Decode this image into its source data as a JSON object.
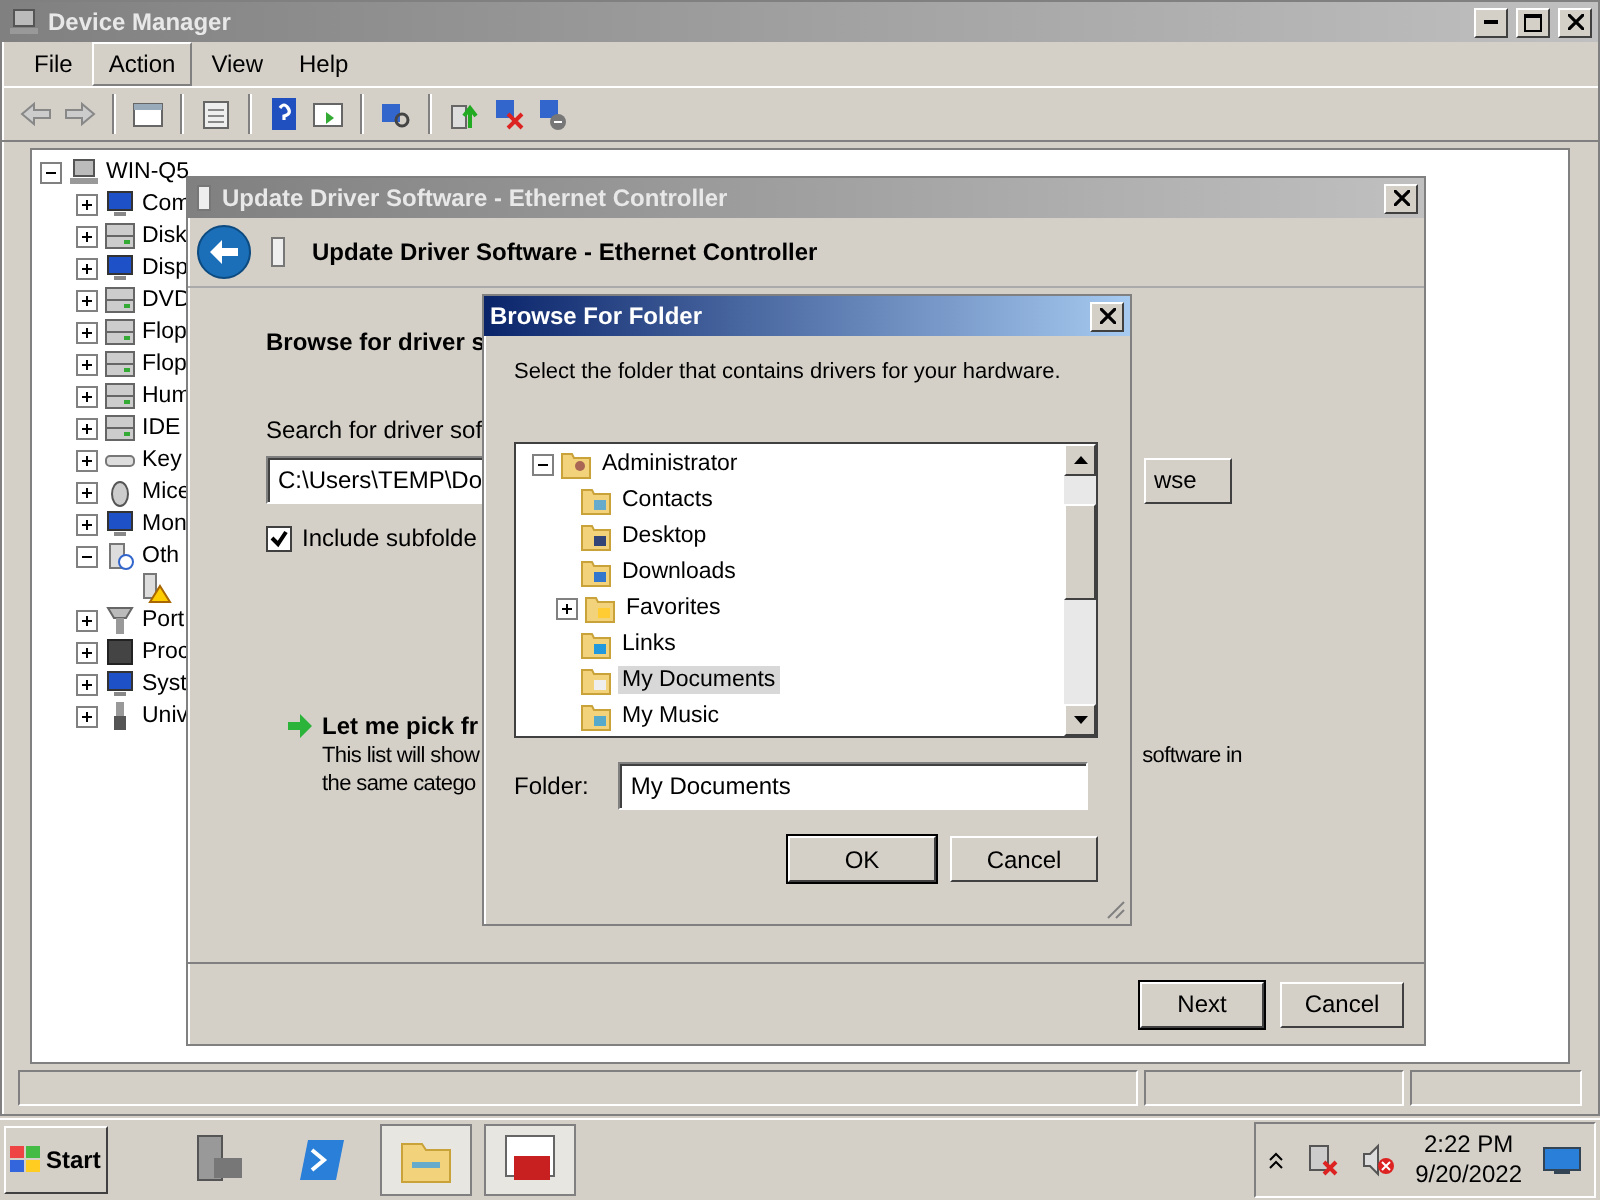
{
  "device_manager": {
    "title": "Device Manager",
    "menu": [
      {
        "label": "File",
        "selected": false
      },
      {
        "label": "Action",
        "selected": true
      },
      {
        "label": "View",
        "selected": false
      },
      {
        "label": "Help",
        "selected": false
      }
    ],
    "tree": {
      "label": "WIN-Q5",
      "expanded": true,
      "children": [
        {
          "label": "Com",
          "expanded": false
        },
        {
          "label": "Disk",
          "expanded": false
        },
        {
          "label": "Disp",
          "expanded": false
        },
        {
          "label": "DVD",
          "expanded": false
        },
        {
          "label": "Flop",
          "expanded": false
        },
        {
          "label": "Flop",
          "expanded": false
        },
        {
          "label": "Hum",
          "expanded": false
        },
        {
          "label": "IDE",
          "expanded": false
        },
        {
          "label": "Key",
          "expanded": false
        },
        {
          "label": "Mice",
          "expanded": false
        },
        {
          "label": "Mon",
          "expanded": false
        },
        {
          "label": "Oth",
          "expanded": true,
          "children": [
            {
              "kind": "warning"
            }
          ]
        },
        {
          "label": "Port",
          "expanded": false
        },
        {
          "label": "Proc",
          "expanded": false
        },
        {
          "label": "Syst",
          "expanded": false
        },
        {
          "label": "Univ",
          "expanded": false
        }
      ]
    }
  },
  "update_driver": {
    "title": "Update Driver Software - Ethernet Controller",
    "header": "Update Driver Software - Ethernet Controller",
    "heading": "Browse for driver s",
    "search_label": "Search for driver sof",
    "path_value": "C:\\Users\\TEMP\\Do",
    "browse_button": "wse",
    "include_subfolders": {
      "label": "Include subfolde",
      "checked": true
    },
    "pick_link": {
      "title": "Let me pick fr",
      "lines": [
        {
          "left": "This list will show",
          "right": "software in"
        },
        {
          "left": "the same catego"
        }
      ]
    },
    "buttons": [
      "Next",
      "Cancel"
    ]
  },
  "browse_folder": {
    "title": "Browse For Folder",
    "instruction": "Select the folder that contains drivers for your hardware.",
    "tree": {
      "label": "Administrator",
      "expanded": true,
      "children": [
        {
          "label": "Contacts",
          "selected": false
        },
        {
          "label": "Desktop",
          "selected": false
        },
        {
          "label": "Downloads",
          "selected": false
        },
        {
          "label": "Favorites",
          "selected": false,
          "expanded": false
        },
        {
          "label": "Links",
          "selected": false
        },
        {
          "label": "My Documents",
          "selected": true
        },
        {
          "label": "My Music",
          "selected": false
        }
      ]
    },
    "folder_label": "Folder:",
    "folder_value": "My Documents",
    "buttons": [
      "OK",
      "Cancel"
    ]
  },
  "taskbar": {
    "start": "Start",
    "apps": [
      {
        "selected": false
      },
      {
        "selected": false
      },
      {
        "selected": true
      },
      {
        "selected": true
      }
    ],
    "time": "2:22 PM",
    "date": "9/20/2022"
  }
}
